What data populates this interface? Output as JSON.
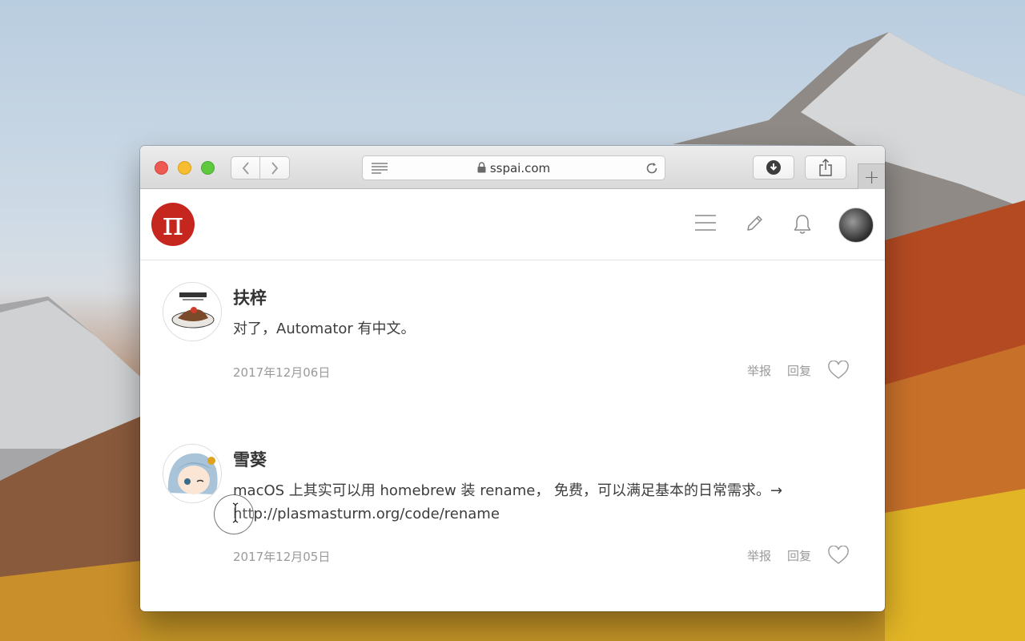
{
  "browser": {
    "url": "sspai.com",
    "new_tab_label": "+"
  },
  "site": {
    "logo_text": "π",
    "accent_color": "#c5261e"
  },
  "icons": {
    "menu": "menu-icon",
    "write": "pencil-icon",
    "notifications": "bell-icon",
    "like": "heart-icon"
  },
  "comments": [
    {
      "author": "扶梓",
      "text": "对了，Automator 有中文。",
      "date": "2017年12月06日",
      "report_label": "举报",
      "reply_label": "回复"
    },
    {
      "author": "雪葵",
      "text": "macOS 上其实可以用 homebrew 装 rename， 免费，可以满足基本的日常需求。→ http://plasmasturm.org/code/rename",
      "date": "2017年12月05日",
      "report_label": "举报",
      "reply_label": "回复"
    }
  ]
}
